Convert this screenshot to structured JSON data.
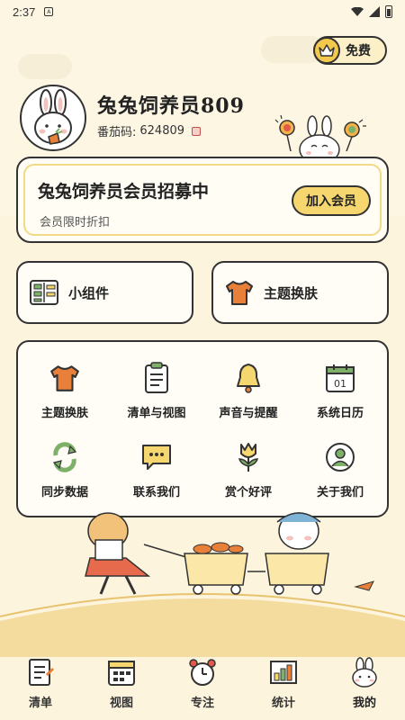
{
  "status_bar": {
    "time": "2:37",
    "sim_glyph": "A"
  },
  "header": {
    "free_label": "免费",
    "username": "兔兔饲养员809",
    "tomato_id_label": "番茄码:",
    "tomato_id_value": "624809"
  },
  "member": {
    "title": "兔兔饲养员会员招募中",
    "subtitle": "会员限时折扣",
    "join_label": "加入会员"
  },
  "quick": [
    {
      "label": "小组件",
      "icon": "widget-icon"
    },
    {
      "label": "主题换肤",
      "icon": "tshirt-icon"
    }
  ],
  "grid": [
    {
      "label": "主题换肤",
      "icon": "tshirt-icon"
    },
    {
      "label": "清单与视图",
      "icon": "clipboard-icon"
    },
    {
      "label": "声音与提醒",
      "icon": "bell-icon"
    },
    {
      "label": "系统日历",
      "icon": "calendar-icon",
      "calendar_day": "01"
    },
    {
      "label": "同步数据",
      "icon": "sync-icon"
    },
    {
      "label": "联系我们",
      "icon": "chat-icon"
    },
    {
      "label": "赏个好评",
      "icon": "tulip-icon"
    },
    {
      "label": "关于我们",
      "icon": "user-icon"
    }
  ],
  "tabs": [
    {
      "label": "清单",
      "icon": "list-icon",
      "active": false
    },
    {
      "label": "视图",
      "icon": "calendar-icon",
      "active": false
    },
    {
      "label": "专注",
      "icon": "alarm-clock-icon",
      "active": false
    },
    {
      "label": "统计",
      "icon": "chart-icon",
      "active": false
    },
    {
      "label": "我的",
      "icon": "bunny-icon",
      "active": true
    }
  ],
  "colors": {
    "background": "#fcf4dc",
    "accent_yellow": "#f6d66f",
    "outline": "#333333",
    "carrot": "#e8803a",
    "green": "#7fb069"
  }
}
